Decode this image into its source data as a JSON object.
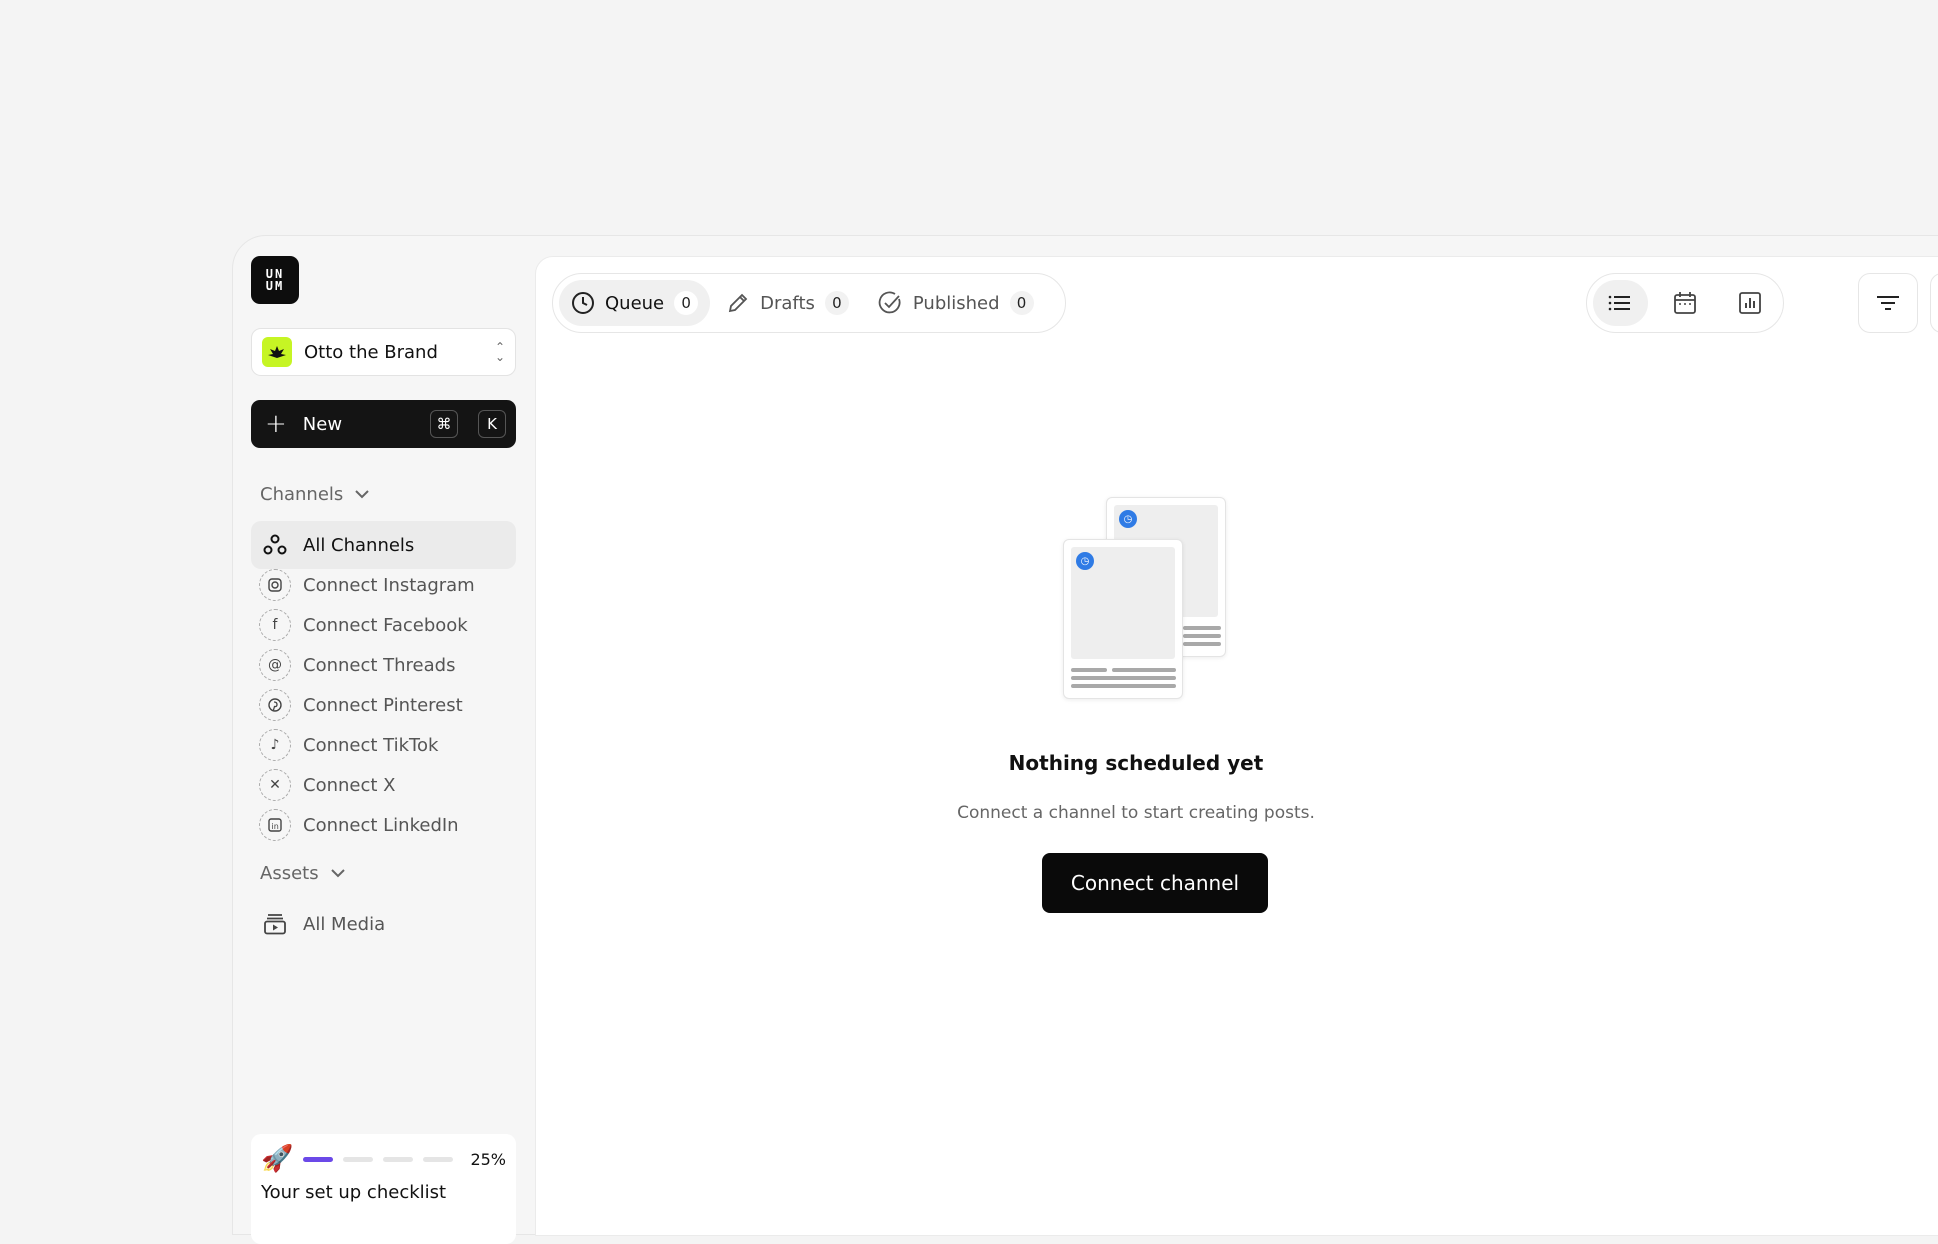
{
  "logo": {
    "line1": "UN",
    "line2": "UM"
  },
  "brand": {
    "name": "Otto the Brand",
    "accent": "#c6f524"
  },
  "new_button": {
    "label": "New",
    "shortcut_mod": "⌘",
    "shortcut_key": "K"
  },
  "channels": {
    "heading": "Channels",
    "items": [
      {
        "label": "All Channels",
        "icon": "all-channels-icon",
        "active": true
      },
      {
        "label": "Connect Instagram",
        "icon": "instagram-icon"
      },
      {
        "label": "Connect Facebook",
        "icon": "facebook-icon"
      },
      {
        "label": "Connect Threads",
        "icon": "threads-icon"
      },
      {
        "label": "Connect Pinterest",
        "icon": "pinterest-icon"
      },
      {
        "label": "Connect TikTok",
        "icon": "tiktok-icon"
      },
      {
        "label": "Connect X",
        "icon": "x-icon"
      },
      {
        "label": "Connect LinkedIn",
        "icon": "linkedin-icon"
      }
    ]
  },
  "assets": {
    "heading": "Assets",
    "items": [
      {
        "label": "All Media",
        "icon": "media-icon"
      }
    ]
  },
  "checklist": {
    "label": "Your set up checklist",
    "percent": "25%",
    "progress_fraction": 0.25,
    "accent": "#6b49e8"
  },
  "tabs": [
    {
      "label": "Queue",
      "count": "0",
      "icon": "clock-icon",
      "active": true
    },
    {
      "label": "Drafts",
      "count": "0",
      "icon": "pencil-icon"
    },
    {
      "label": "Published",
      "count": "0",
      "icon": "check-circle-icon"
    }
  ],
  "empty_state": {
    "title": "Nothing scheduled yet",
    "subtitle": "Connect a channel to start creating posts.",
    "button": "Connect channel",
    "dot_color": "#2f7be5"
  }
}
